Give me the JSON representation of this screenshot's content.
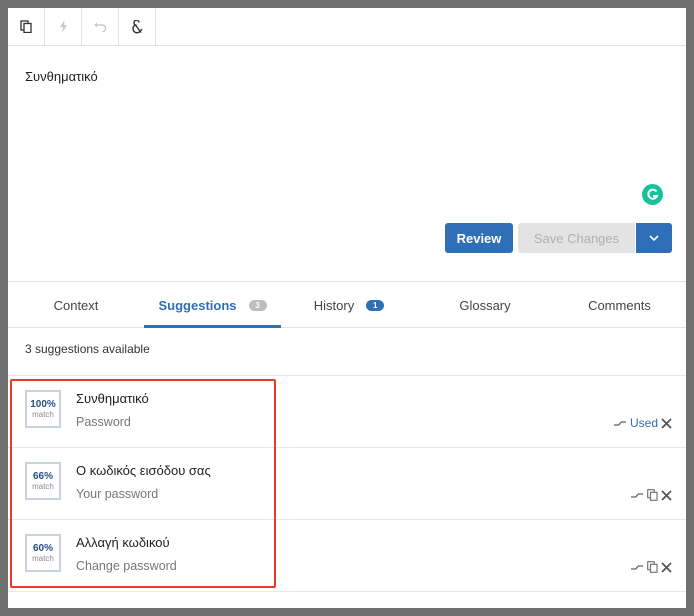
{
  "toolbar": {
    "buttons": [
      {
        "id": "copy",
        "icon": "copy-icon"
      },
      {
        "id": "quick",
        "icon": "lightning-icon"
      },
      {
        "id": "undo",
        "icon": "undo-icon"
      },
      {
        "id": "special",
        "icon": "special-chars-icon"
      }
    ]
  },
  "editor": {
    "text": "Συνθηματικό",
    "review_label": "Review",
    "save_label": "Save Changes"
  },
  "tabs": [
    {
      "label": "Context",
      "badge": ""
    },
    {
      "label": "Suggestions",
      "badge": "3",
      "active": true
    },
    {
      "label": "History",
      "badge": "1"
    },
    {
      "label": "Glossary",
      "badge": ""
    },
    {
      "label": "Comments",
      "badge": ""
    }
  ],
  "suggestions": {
    "count_text": "3 suggestions available",
    "match_label": "match",
    "used_label": "Used",
    "items": [
      {
        "pct": "100%",
        "target": "Συνθηματικό",
        "source": "Password",
        "used": true
      },
      {
        "pct": "66%",
        "target": "Ο κωδικός εισόδου σας",
        "source": "Your password",
        "used": false
      },
      {
        "pct": "60%",
        "target": "Αλλαγή κωδικού",
        "source": "Change password",
        "used": false
      }
    ]
  },
  "colors": {
    "accent": "#2f6fb7",
    "highlight": "#e53b2c",
    "grammarly": "#15c39a"
  }
}
